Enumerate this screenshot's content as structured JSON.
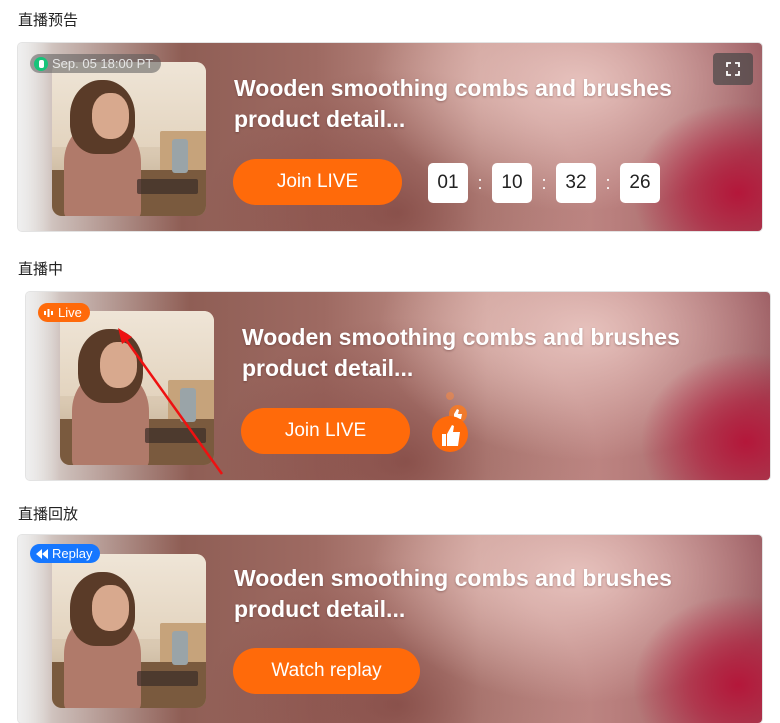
{
  "sections": [
    {
      "label": "直播预告",
      "badge": "Sep. 05 18:00 PT",
      "title_line1": "Wooden smoothing combs and brushes",
      "title_line2": "product detail...",
      "button": "Join LIVE",
      "countdown": [
        "01",
        "10",
        "32",
        "26"
      ],
      "countdown_sep": ":"
    },
    {
      "label": "直播中",
      "badge": "Live",
      "title_line1": "Wooden smoothing combs and brushes",
      "title_line2": "product detail...",
      "button": "Join LIVE"
    },
    {
      "label": "直播回放",
      "badge": "Replay",
      "title_line1": "Wooden smoothing combs and brushes",
      "title_line2": "product detail...",
      "button": "Watch replay"
    }
  ],
  "colors": {
    "accent_orange": "#ff6a0a",
    "replay_blue": "#1677ff",
    "scheduled_green": "#17c47a",
    "annotation_red": "#ee1111"
  },
  "icons": [
    "clock-dot-icon",
    "expand-icon",
    "live-sound-icon",
    "rewind-icon",
    "thumbs-up-icon"
  ]
}
